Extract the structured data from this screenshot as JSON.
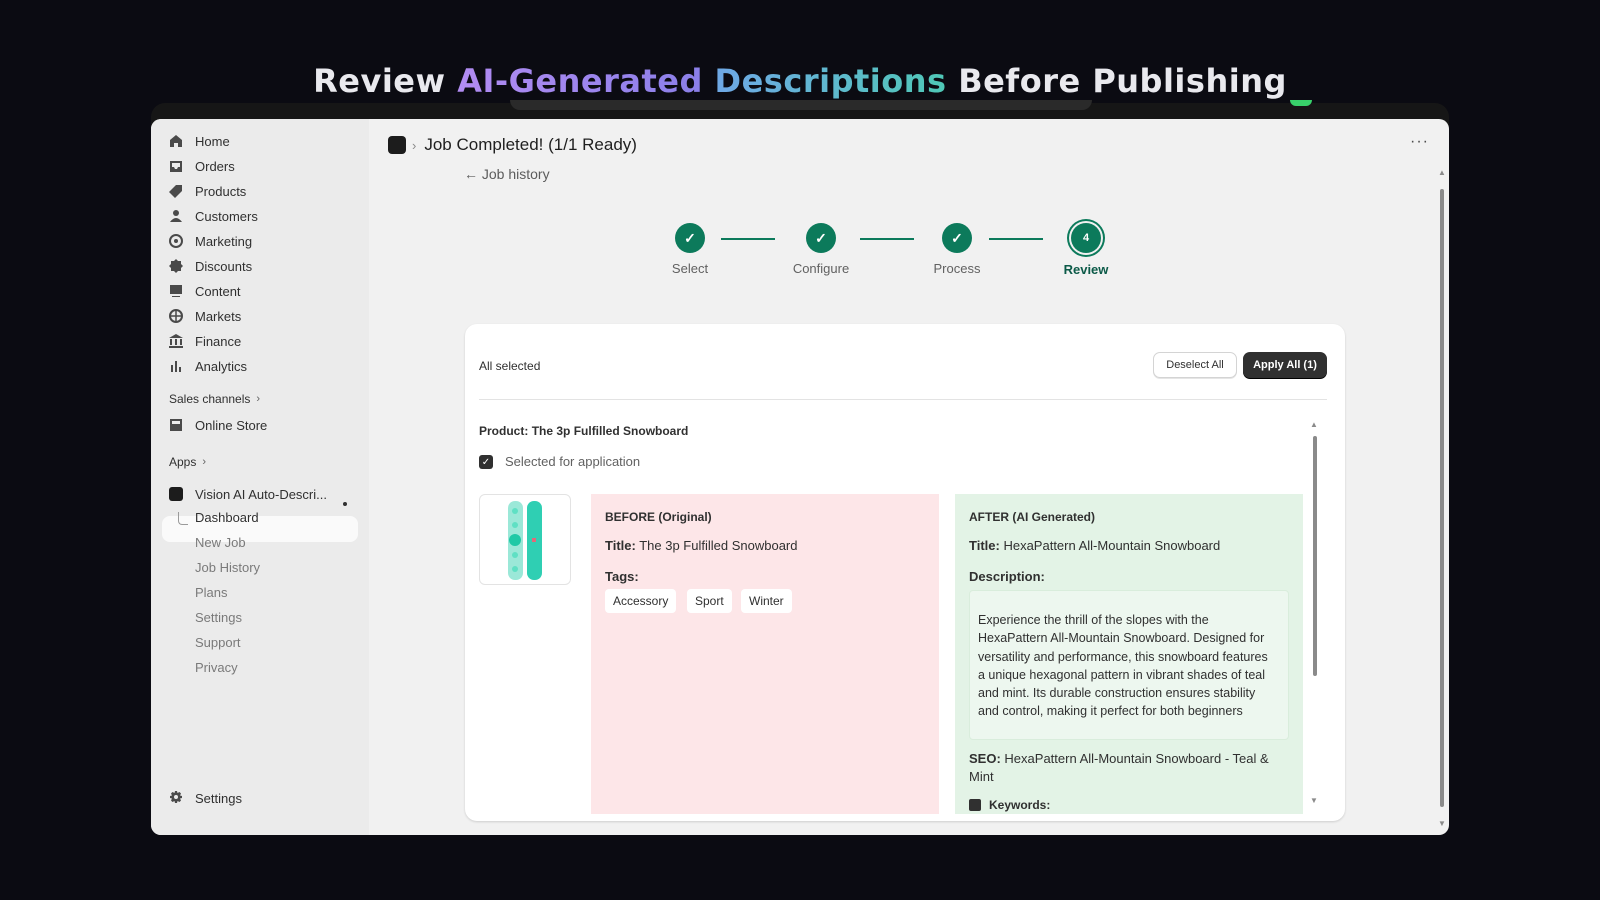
{
  "headline": {
    "part1": "Review ",
    "part2": "AI-Generated",
    "part3": " ",
    "part4": "Descriptions",
    "part5": " Before Publishing"
  },
  "sidebar": {
    "items": [
      {
        "label": "Home",
        "icon": "home-icon"
      },
      {
        "label": "Orders",
        "icon": "inbox-icon"
      },
      {
        "label": "Products",
        "icon": "tag-icon"
      },
      {
        "label": "Customers",
        "icon": "person-icon"
      },
      {
        "label": "Marketing",
        "icon": "target-icon"
      },
      {
        "label": "Discounts",
        "icon": "discount-icon"
      },
      {
        "label": "Content",
        "icon": "content-icon"
      },
      {
        "label": "Markets",
        "icon": "globe-icon"
      },
      {
        "label": "Finance",
        "icon": "bank-icon"
      },
      {
        "label": "Analytics",
        "icon": "chart-icon"
      }
    ],
    "sales_channels_label": "Sales channels",
    "online_store_label": "Online Store",
    "apps_label": "Apps",
    "app_name": "Vision AI Auto-Descri...",
    "app_subitems": [
      "Dashboard",
      "New Job",
      "Job History",
      "Plans",
      "Settings",
      "Support",
      "Privacy"
    ],
    "settings_label": "Settings"
  },
  "header": {
    "title": "Job Completed! (1/1 Ready)",
    "back_link": "← Job history",
    "more": "···"
  },
  "stepper": {
    "steps": [
      {
        "label": "Select",
        "mark": "✓"
      },
      {
        "label": "Configure",
        "mark": "✓"
      },
      {
        "label": "Process",
        "mark": "✓"
      },
      {
        "label": "Review",
        "mark": "4"
      }
    ],
    "current_step": 4
  },
  "card": {
    "selection_status": "All selected",
    "deselect_label": "Deselect All",
    "apply_label": "Apply All (1)",
    "product_prefix": "Product:",
    "product_name": "The 3p Fulfilled Snowboard",
    "checkbox_mark": "✓",
    "checkbox_label": "Selected for application",
    "before": {
      "heading": "BEFORE (Original)",
      "title_label": "Title:",
      "title_value": "The 3p Fulfilled Snowboard",
      "tags_label": "Tags:",
      "tags": [
        "Accessory",
        "Sport",
        "Winter"
      ]
    },
    "after": {
      "heading": "AFTER (AI Generated)",
      "title_label": "Title:",
      "title_value": "HexaPattern All-Mountain Snowboard",
      "description_label": "Description:",
      "description": "Experience the thrill of the slopes with the HexaPattern All-Mountain Snowboard. Designed for versatility and performance, this snowboard features a unique hexagonal pattern in vibrant shades of teal and mint. Its durable construction ensures stability and control, making it perfect for both beginners",
      "seo_label": "SEO:",
      "seo_value": "HexaPattern All-Mountain Snowboard - Teal & Mint",
      "keywords_label": "Keywords:"
    }
  },
  "colors": {
    "accent_green": "#0c7a5b",
    "before_bg": "#fde6e8",
    "after_bg": "#e3f3e6",
    "dark_button": "#303030"
  }
}
